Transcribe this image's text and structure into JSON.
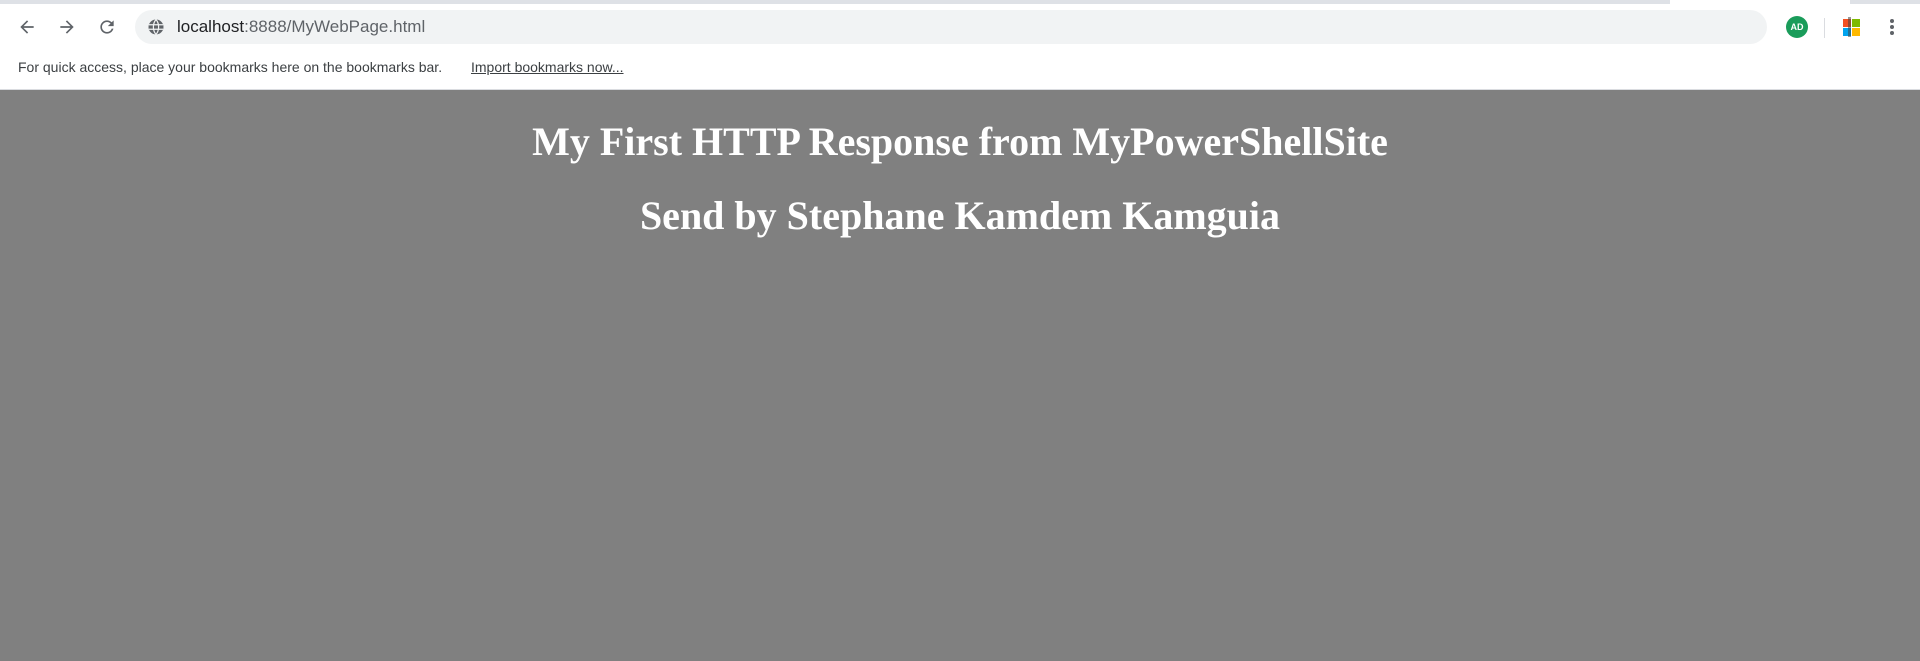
{
  "browser": {
    "url_host": "localhost",
    "url_path": ":8888/MyWebPage.html",
    "extensions": {
      "adblock_label": "AD"
    }
  },
  "bookmarks_bar": {
    "hint": "For quick access, place your bookmarks here on the bookmarks bar.",
    "import_link": "Import bookmarks now..."
  },
  "page": {
    "background_color": "#808080",
    "heading_1": "My First HTTP Response from MyPowerShellSite",
    "heading_2": "Send by Stephane Kamdem Kamguia"
  },
  "icons": {
    "back": "arrow-left-icon",
    "forward": "arrow-right-icon",
    "reload": "reload-icon",
    "site_info": "globe-icon",
    "adblock": "adblock-extension-icon",
    "office": "office-extension-icon",
    "menu": "kebab-menu-icon"
  }
}
